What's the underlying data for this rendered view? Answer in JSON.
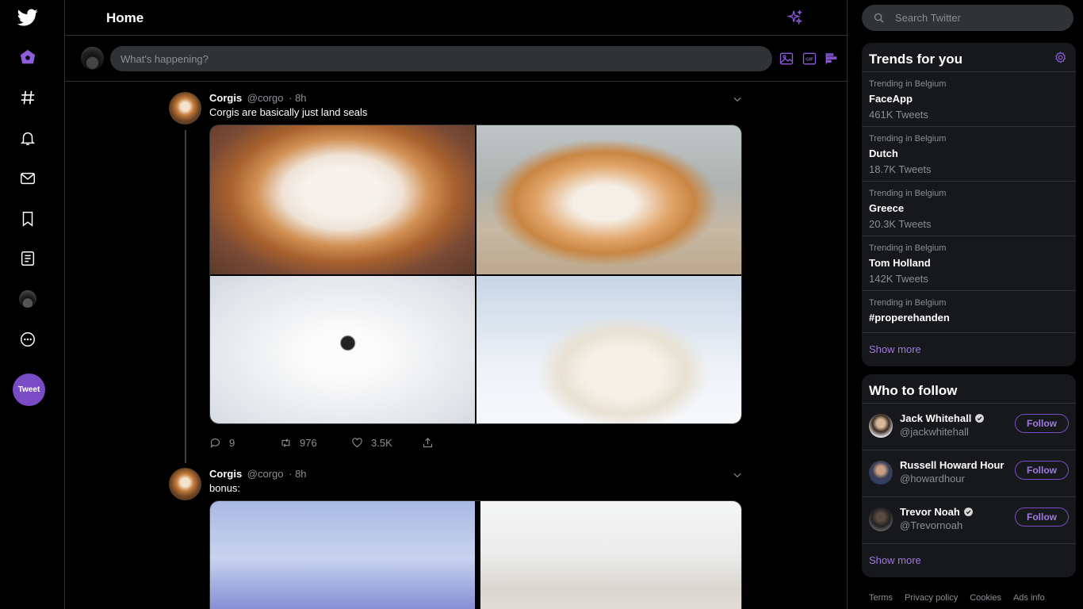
{
  "header": {
    "title": "Home"
  },
  "composer": {
    "placeholder": "What's happening?"
  },
  "nav": {
    "tweet_label": "Tweet"
  },
  "tweets": [
    {
      "name": "Corgis",
      "handle": "@corgo",
      "time": "· 8h",
      "text": "Corgis are basically just land seals",
      "replies": "9",
      "retweets": "976",
      "likes": "3.5K"
    },
    {
      "name": "Corgis",
      "handle": "@corgo",
      "time": "· 8h",
      "text": "bonus:"
    }
  ],
  "search": {
    "placeholder": "Search Twitter"
  },
  "trends": {
    "title": "Trends for you",
    "items": [
      {
        "context": "Trending in Belgium",
        "topic": "FaceApp",
        "count": "461K Tweets"
      },
      {
        "context": "Trending in Belgium",
        "topic": "Dutch",
        "count": "18.7K Tweets"
      },
      {
        "context": "Trending in Belgium",
        "topic": "Greece",
        "count": "20.3K Tweets"
      },
      {
        "context": "Trending in Belgium",
        "topic": "Tom Holland",
        "count": "142K Tweets"
      },
      {
        "context": "Trending in Belgium",
        "topic": "#properehanden",
        "count": ""
      }
    ],
    "show_more": "Show more"
  },
  "who_to_follow": {
    "title": "Who to follow",
    "items": [
      {
        "name": "Jack Whitehall",
        "handle": "@jackwhitehall",
        "verified": true,
        "button": "Follow"
      },
      {
        "name": "Russell Howard Hour",
        "handle": "@howardhour",
        "verified": false,
        "button": "Follow"
      },
      {
        "name": "Trevor Noah",
        "handle": "@Trevornoah",
        "verified": true,
        "button": "Follow"
      }
    ],
    "show_more": "Show more"
  },
  "footer": {
    "terms": "Terms",
    "privacy": "Privacy policy",
    "cookies": "Cookies",
    "ads": "Ads info"
  },
  "colors": {
    "accent": "#794bc4",
    "accent_text": "#9f7ae0",
    "background": "#000000",
    "panel": "#16181c",
    "muted": "#8b8f94"
  }
}
